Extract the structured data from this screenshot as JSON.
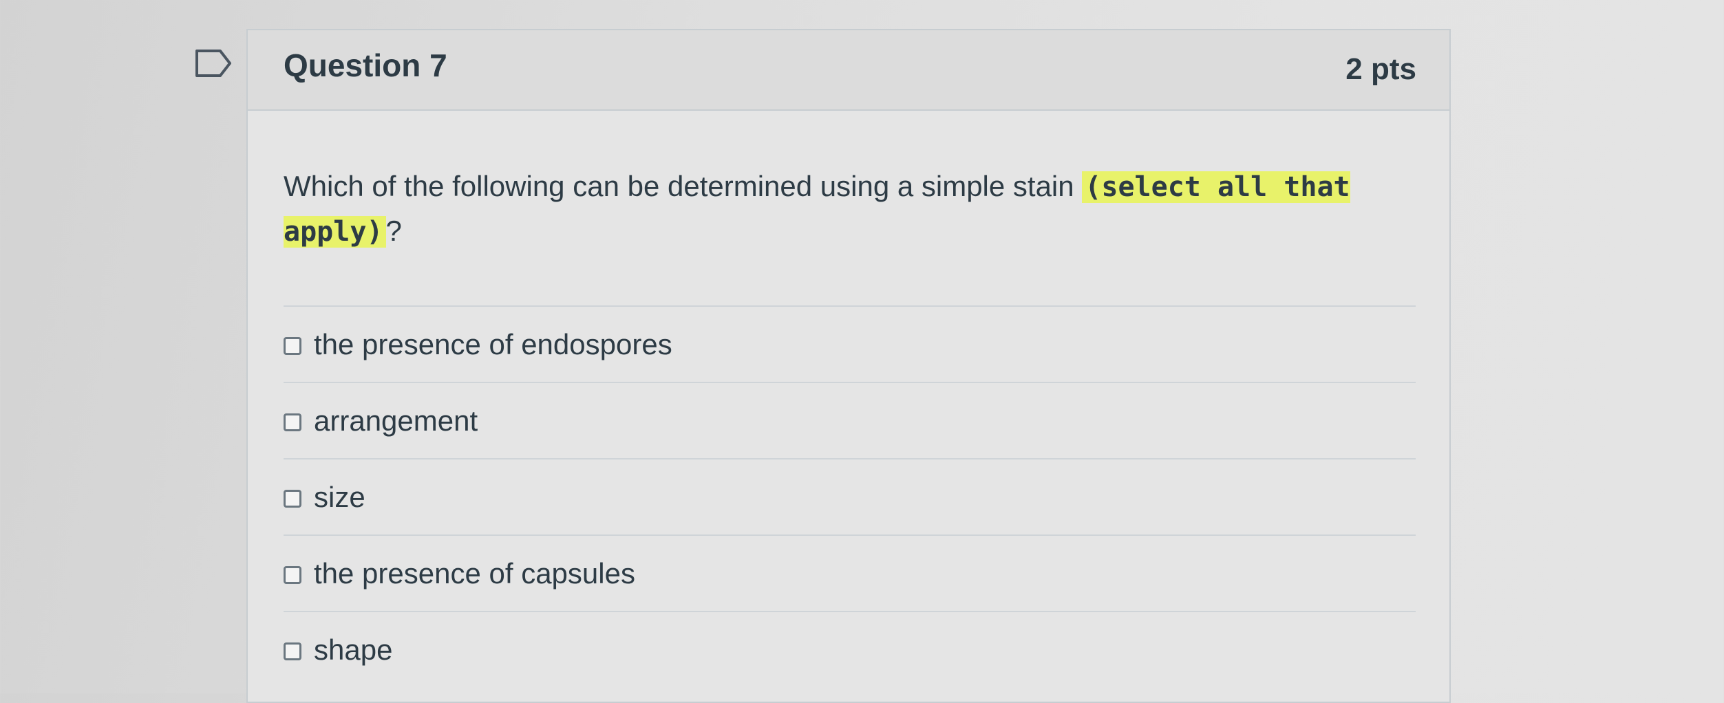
{
  "question": {
    "title": "Question 7",
    "points": "2 pts",
    "text_before": "Which of the following can be determined using a simple stain ",
    "highlight": "(select all that apply)",
    "text_after": "?",
    "answers": [
      {
        "label": "the presence of endospores",
        "checked": false
      },
      {
        "label": "arrangement",
        "checked": false
      },
      {
        "label": "size",
        "checked": false
      },
      {
        "label": "the presence of capsules",
        "checked": false
      },
      {
        "label": "shape",
        "checked": false
      }
    ]
  },
  "colors": {
    "highlight": "#e8f26a",
    "text": "#2d3b45",
    "border": "#c7cdd1"
  },
  "icons": {
    "flag": "flag-question-icon"
  }
}
